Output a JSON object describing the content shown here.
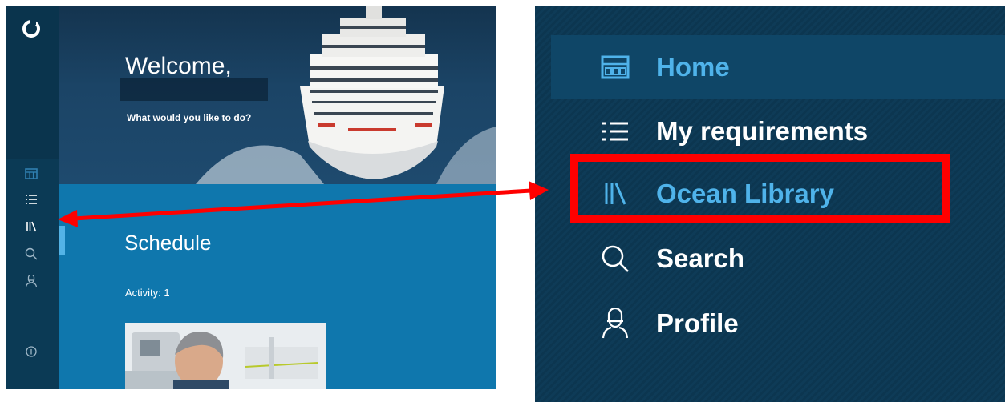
{
  "app": {
    "hero": {
      "welcome": "Welcome,",
      "prompt": "What would you like to do?"
    },
    "rail": {
      "logo_icon": "ocean-logo-icon",
      "items": [
        {
          "icon": "home-grid-icon",
          "active": false
        },
        {
          "icon": "list-icon",
          "active": false
        },
        {
          "icon": "library-icon",
          "active": true
        },
        {
          "icon": "search-icon",
          "active": false
        },
        {
          "icon": "profile-icon",
          "active": false
        }
      ],
      "info_icon": "info-icon"
    },
    "schedule": {
      "title": "Schedule",
      "activity": "Activity: 1"
    }
  },
  "menu": {
    "items": [
      {
        "label": "Home",
        "icon": "home-grid-icon",
        "active": true
      },
      {
        "label": "My requirements",
        "icon": "list-icon",
        "active": false
      },
      {
        "label": "Ocean Library",
        "icon": "library-icon",
        "active": false,
        "highlighted": true
      },
      {
        "label": "Search",
        "icon": "search-icon",
        "active": false
      },
      {
        "label": "Profile",
        "icon": "profile-icon",
        "active": false
      }
    ]
  },
  "colors": {
    "rail": "#0b3a55",
    "content": "#0f77ad",
    "accent": "#4fb3ea",
    "highlight": "#ff0000"
  }
}
